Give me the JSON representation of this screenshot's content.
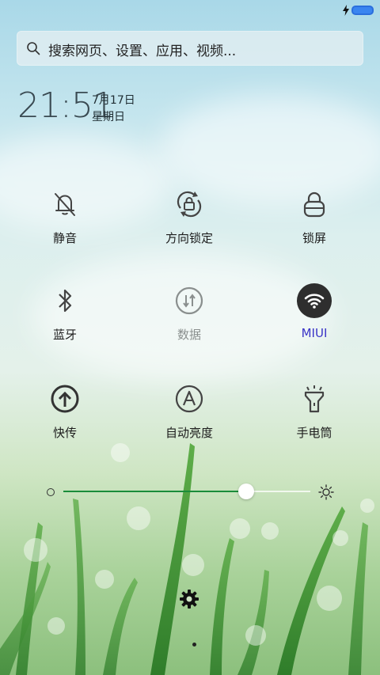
{
  "status_bar": {
    "battery_level": 1.0,
    "charging": true,
    "battery_color": "#3a85f0"
  },
  "search": {
    "placeholder": "搜索网页、设置、应用、视频..."
  },
  "clock": {
    "time": "21:51",
    "date": "7月17日",
    "weekday": "星期日"
  },
  "toggles": [
    {
      "label": "静音",
      "icon": "bell-off-icon",
      "state": "off"
    },
    {
      "label": "方向锁定",
      "icon": "rotation-lock-icon",
      "state": "off"
    },
    {
      "label": "锁屏",
      "icon": "lock-icon",
      "state": "off"
    },
    {
      "label": "蓝牙",
      "icon": "bluetooth-icon",
      "state": "off"
    },
    {
      "label": "数据",
      "icon": "mobile-data-icon",
      "state": "disabled"
    },
    {
      "label": "MIUI",
      "icon": "wifi-icon",
      "state": "on"
    },
    {
      "label": "快传",
      "icon": "upload-icon",
      "state": "off"
    },
    {
      "label": "自动亮度",
      "icon": "auto-brightness-icon",
      "state": "off"
    },
    {
      "label": "手电筒",
      "icon": "flashlight-icon",
      "state": "off"
    }
  ],
  "brightness": {
    "level": 0.74,
    "fill_color": "#1a8c3a"
  },
  "pager": {
    "pages": 1,
    "current": 1
  },
  "colors": {
    "active_label": "#3a34c7",
    "active_toggle_bg": "#2e2e2e"
  }
}
